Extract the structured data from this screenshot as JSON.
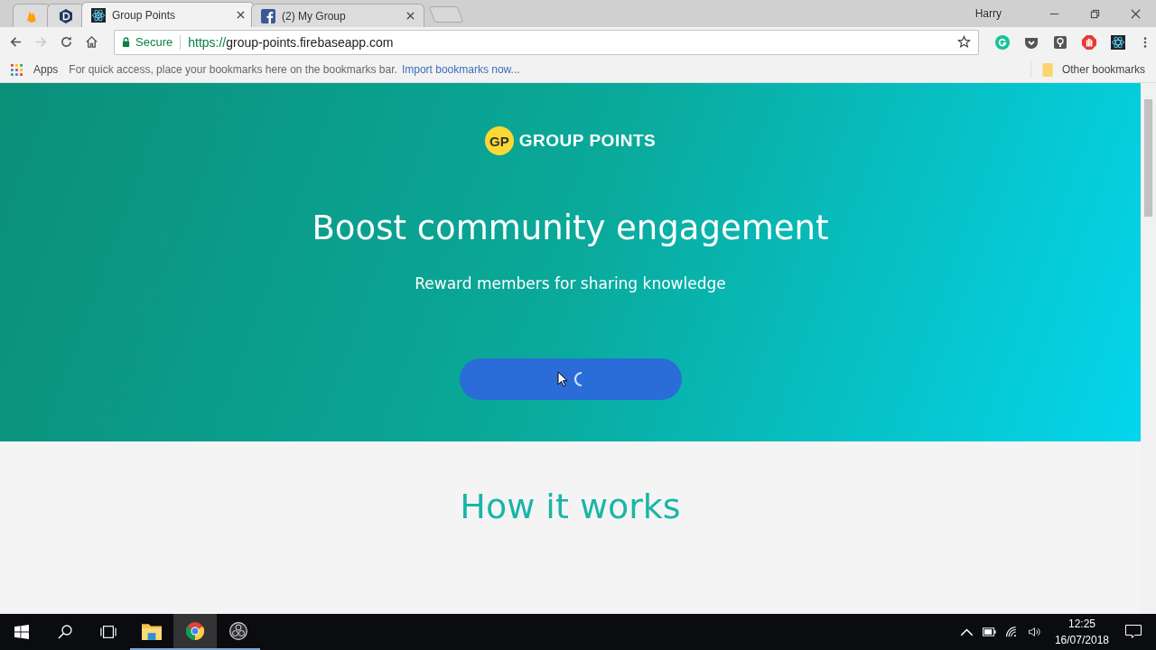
{
  "browser": {
    "tabs": [
      {
        "kind": "flame",
        "selected": false
      },
      {
        "kind": "letter",
        "selected": false
      },
      {
        "kind": "atom",
        "title": "Group Points",
        "selected": true
      },
      {
        "kind": "social",
        "title": "(2) My Group",
        "selected": false
      }
    ],
    "profile": "Harry",
    "address": {
      "secure_label": "Secure",
      "scheme": "https://",
      "host": "group-points.firebaseapp.com"
    },
    "bookmarks": {
      "apps": "Apps",
      "hint": "For quick access, place your bookmarks here on the bookmarks bar.",
      "import_link": "Import bookmarks now...",
      "other": "Other bookmarks"
    }
  },
  "page": {
    "logo_mark": "GP",
    "logo_text": "GROUP POINTS",
    "headline": "Boost community engagement",
    "subtitle": "Reward members for sharing knowledge",
    "button": {
      "loading": true
    },
    "section_title": "How it works"
  },
  "taskbar": {
    "apps": [
      {
        "kind": "folder",
        "selected": false,
        "running": true
      },
      {
        "kind": "browser",
        "selected": true,
        "running": true
      },
      {
        "kind": "recorder",
        "selected": false,
        "running": true
      }
    ],
    "time": "12:25",
    "date": "16/07/2018"
  }
}
